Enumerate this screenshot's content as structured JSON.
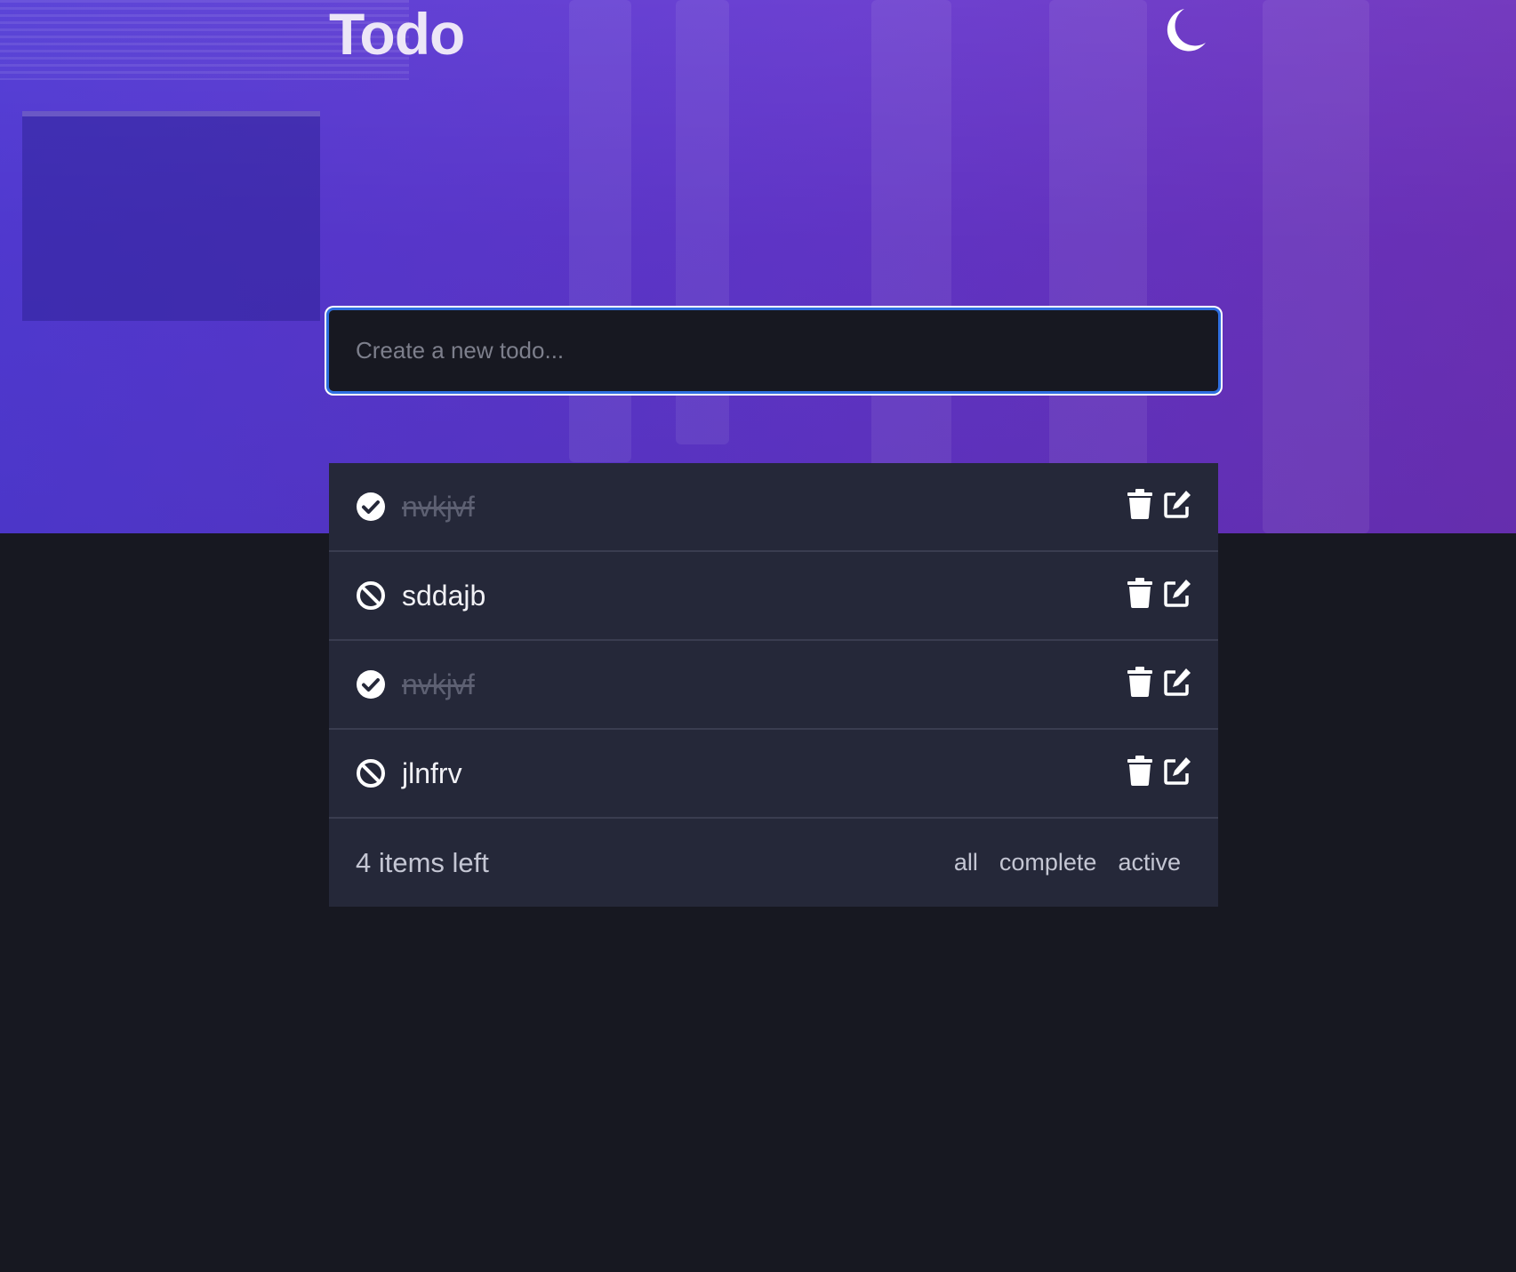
{
  "app": {
    "title": "Todo",
    "theme_icon": "moon-icon"
  },
  "new_todo": {
    "value": "",
    "placeholder": "Create a new todo..."
  },
  "todos": [
    {
      "text": "nvkjvf",
      "completed": true,
      "status_icon": "check-circle-icon"
    },
    {
      "text": "sddajb",
      "completed": false,
      "status_icon": "ban-icon"
    },
    {
      "text": "nvkjvf",
      "completed": true,
      "status_icon": "check-circle-icon"
    },
    {
      "text": "jlnfrv",
      "completed": false,
      "status_icon": "ban-icon"
    }
  ],
  "row_actions": {
    "delete_icon": "trash-icon",
    "edit_icon": "edit-icon"
  },
  "footer": {
    "items_left": "4 items left",
    "filters": [
      "all",
      "complete",
      "active"
    ]
  },
  "colors": {
    "accent": "#2f6fe0",
    "background": "#171821",
    "panel": "#252839"
  }
}
